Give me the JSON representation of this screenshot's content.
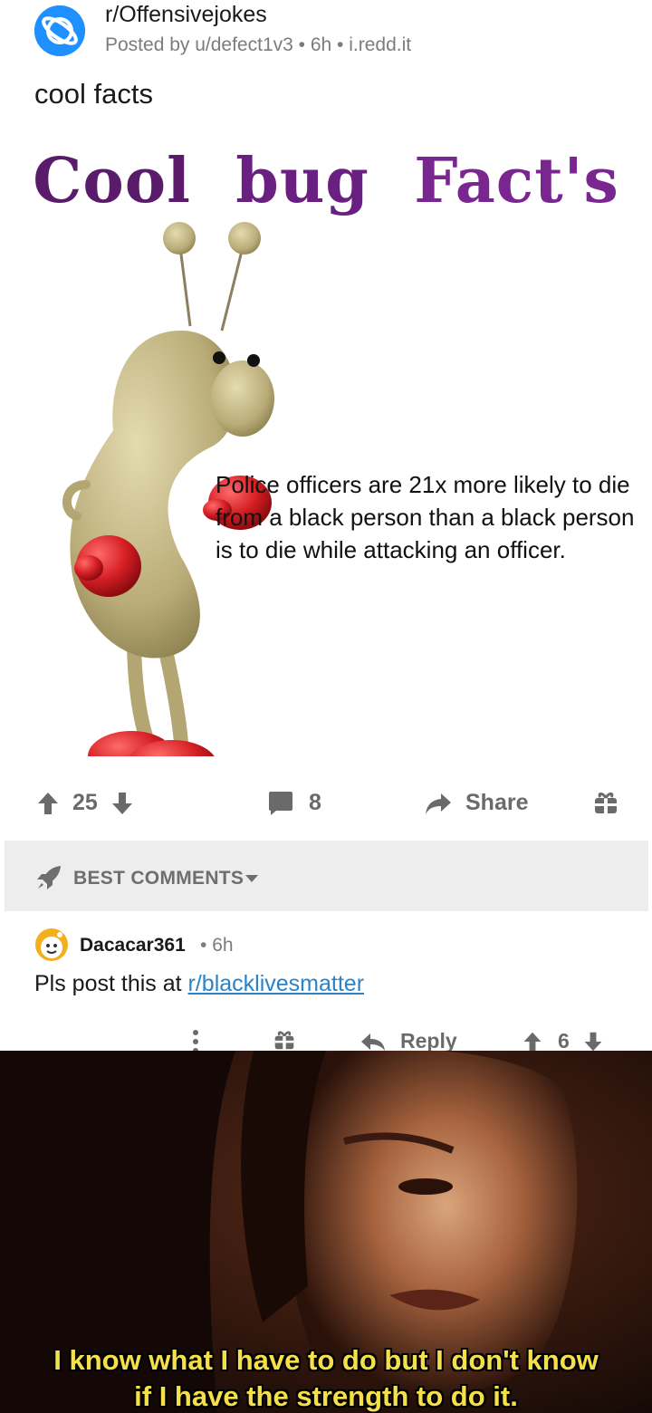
{
  "post": {
    "subreddit": "r/Offensivejokes",
    "posted_by": "Posted by u/defect1v3",
    "age": "6h",
    "domain": "i.redd.it",
    "title": "cool facts"
  },
  "meme": {
    "title_words": [
      "Cool",
      "bug",
      "Fact's"
    ],
    "text": "Police officers are 21x more likely to die from a black person than a black person is to die while attacking an officer.",
    "colors": {
      "title": "#6a2080",
      "bug_body": "#c9bd8a",
      "gloves": "#d41e24"
    }
  },
  "actions": {
    "score": "25",
    "comments": "8",
    "share_label": "Share"
  },
  "comments_header": {
    "sort_label": "BEST COMMENTS"
  },
  "comment": {
    "user": "Dacacar361",
    "age": "6h",
    "body_prefix": "Pls post this at ",
    "link": "r/blacklivesmatter",
    "reply_label": "Reply",
    "score": "6"
  },
  "reaction": {
    "caption_line1": "I know what I have to do but I don't know",
    "caption_line2": "if I have the strength to do it."
  }
}
